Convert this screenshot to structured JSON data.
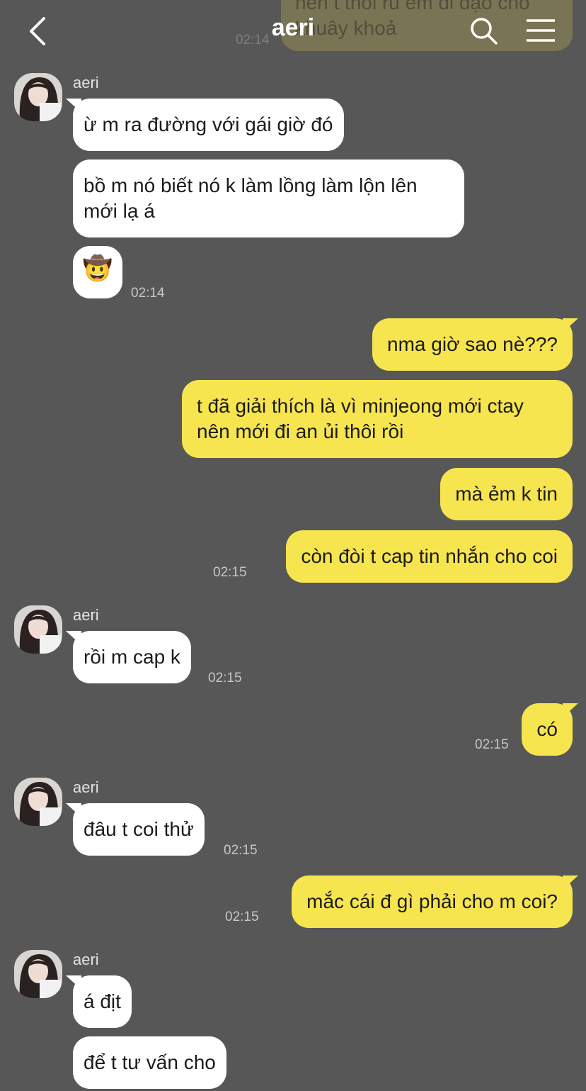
{
  "header": {
    "title": "aeri",
    "back_icon": "chevron-left-icon",
    "search_icon": "search-icon",
    "menu_icon": "menu-icon"
  },
  "ghost": {
    "text": "nên t thôi rủ em đi dạo cho khuây khoả",
    "time": "02:14"
  },
  "messages": [
    {
      "sender": "aeri"
    },
    {
      "text": "ừ m ra đường với gái giờ đó"
    },
    {
      "text": "bồ m nó biết nó k làm lồng làm lộn lên mới lạ á"
    },
    {
      "emoji": "🤠",
      "time": "02:14"
    },
    {
      "text": "nma giờ sao nè???"
    },
    {
      "text": "t đã giải thích là vì minjeong mới ctay nên mới đi an ủi thôi rồi"
    },
    {
      "text": "mà ẻm k tin"
    },
    {
      "text": "còn đòi t cap tin nhắn cho coi",
      "time": "02:15"
    },
    {
      "sender": "aeri",
      "text": "rồi m cap k",
      "time": "02:15"
    },
    {
      "text": "có",
      "time": "02:15"
    },
    {
      "sender": "aeri",
      "text": "đâu t coi thử",
      "time": "02:15"
    },
    {
      "text": "mắc cái đ gì phải cho m coi?",
      "time": "02:15"
    },
    {
      "sender": "aeri",
      "text": "á địt"
    },
    {
      "text": "để t tư vấn cho"
    }
  ],
  "colors": {
    "background": "#575757",
    "incoming_bubble": "#ffffff",
    "outgoing_bubble": "#f6e54e"
  }
}
